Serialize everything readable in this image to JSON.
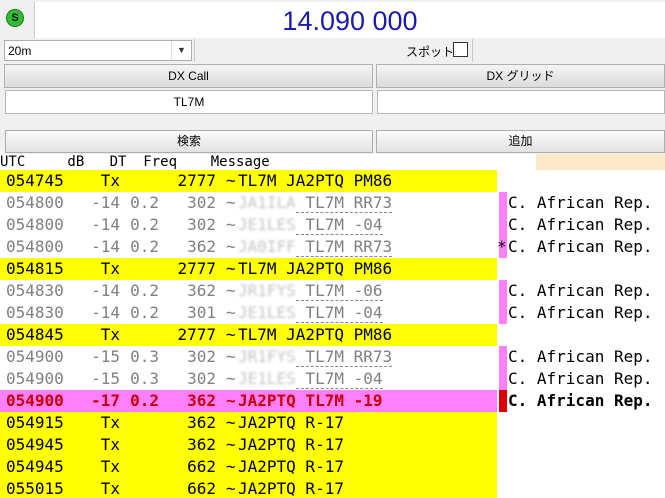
{
  "status_indicator": {
    "label": "S",
    "color": "#2ec02e"
  },
  "frequency": {
    "display": "14.090 000",
    "color": "#1b1bb0"
  },
  "band": {
    "selected": "20m"
  },
  "spot": {
    "label": "スポット",
    "checked": false
  },
  "dx": {
    "call_header": "DX Call",
    "grid_header": "DX グリッド",
    "call_value": "TL7M",
    "grid_value": ""
  },
  "buttons": {
    "search": "検索",
    "add": "追加"
  },
  "table": {
    "header": "UTC     dB   DT  Freq    Message",
    "colors": {
      "tx": "#ffff00",
      "highlight": "#ff80ff",
      "highlight_text": "#cc0000"
    },
    "rows": [
      {
        "type": "tx",
        "utc": "054745",
        "db": "Tx",
        "dt": "",
        "freq": "2777",
        "tilde": "~",
        "call": "TL7M",
        "msg": "TL7M JA2PTQ PM86",
        "country": "",
        "flag": ""
      },
      {
        "type": "rx",
        "utc": "054800",
        "db": "-14",
        "dt": "0.2",
        "freq": "302",
        "tilde": "~",
        "call": "JA1ILA",
        "msg": "TL7M RR73",
        "country": "C. African Rep.",
        "flag": "pink"
      },
      {
        "type": "rx",
        "utc": "054800",
        "db": "-14",
        "dt": "0.2",
        "freq": "302",
        "tilde": "~",
        "call": "JE1LES",
        "msg": "TL7M -04",
        "country": "C. African Rep.",
        "flag": "pink"
      },
      {
        "type": "rx",
        "utc": "054800",
        "db": "-14",
        "dt": "0.2",
        "freq": "362",
        "tilde": "~",
        "call": "JA0IFF",
        "msg": "TL7M RR73",
        "country": "C. African Rep.",
        "flag": "pink",
        "asterisk": "*"
      },
      {
        "type": "tx",
        "utc": "054815",
        "db": "Tx",
        "dt": "",
        "freq": "2777",
        "tilde": "~",
        "call": "TL7M",
        "msg": "TL7M JA2PTQ PM86",
        "country": "",
        "flag": ""
      },
      {
        "type": "rx",
        "utc": "054830",
        "db": "-14",
        "dt": "0.2",
        "freq": "362",
        "tilde": "~",
        "call": "JR1FYS",
        "msg": "TL7M -06",
        "country": "C. African Rep.",
        "flag": "pink"
      },
      {
        "type": "rx",
        "utc": "054830",
        "db": "-14",
        "dt": "0.2",
        "freq": "301",
        "tilde": "~",
        "call": "JE1LES",
        "msg": "TL7M -04",
        "country": "C. African Rep.",
        "flag": "pink"
      },
      {
        "type": "tx",
        "utc": "054845",
        "db": "Tx",
        "dt": "",
        "freq": "2777",
        "tilde": "~",
        "call": "TL7M",
        "msg": "TL7M JA2PTQ PM86",
        "country": "",
        "flag": ""
      },
      {
        "type": "rx",
        "utc": "054900",
        "db": "-15",
        "dt": "0.3",
        "freq": "302",
        "tilde": "~",
        "call": "JR1FYS",
        "msg": "TL7M RR73",
        "country": "C. African Rep.",
        "flag": "pink"
      },
      {
        "type": "rx",
        "utc": "054900",
        "db": "-15",
        "dt": "0.3",
        "freq": "302",
        "tilde": "~",
        "call": "JE1LES",
        "msg": "TL7M -04",
        "country": "C. African Rep.",
        "flag": "pink"
      },
      {
        "type": "hl",
        "utc": "054900",
        "db": "-17",
        "dt": "0.2",
        "freq": "362",
        "tilde": "~",
        "call": "JA2PTQ",
        "msg": "TL7M -19",
        "country": "C. African Rep.",
        "flag": "red"
      },
      {
        "type": "tx",
        "utc": "054915",
        "db": "Tx",
        "dt": "",
        "freq": "362",
        "tilde": "~",
        "call": "TL7M",
        "msg": "JA2PTQ R-17",
        "country": "",
        "flag": ""
      },
      {
        "type": "tx",
        "utc": "054945",
        "db": "Tx",
        "dt": "",
        "freq": "362",
        "tilde": "~",
        "call": "TL7M",
        "msg": "JA2PTQ R-17",
        "country": "",
        "flag": ""
      },
      {
        "type": "tx",
        "utc": "054945",
        "db": "Tx",
        "dt": "",
        "freq": "662",
        "tilde": "~",
        "call": "TL7M",
        "msg": "JA2PTQ R-17",
        "country": "",
        "flag": ""
      },
      {
        "type": "tx",
        "utc": "055015",
        "db": "Tx",
        "dt": "",
        "freq": "662",
        "tilde": "~",
        "call": "TL7M",
        "msg": "JA2PTQ R-17",
        "country": "",
        "flag": ""
      }
    ]
  }
}
